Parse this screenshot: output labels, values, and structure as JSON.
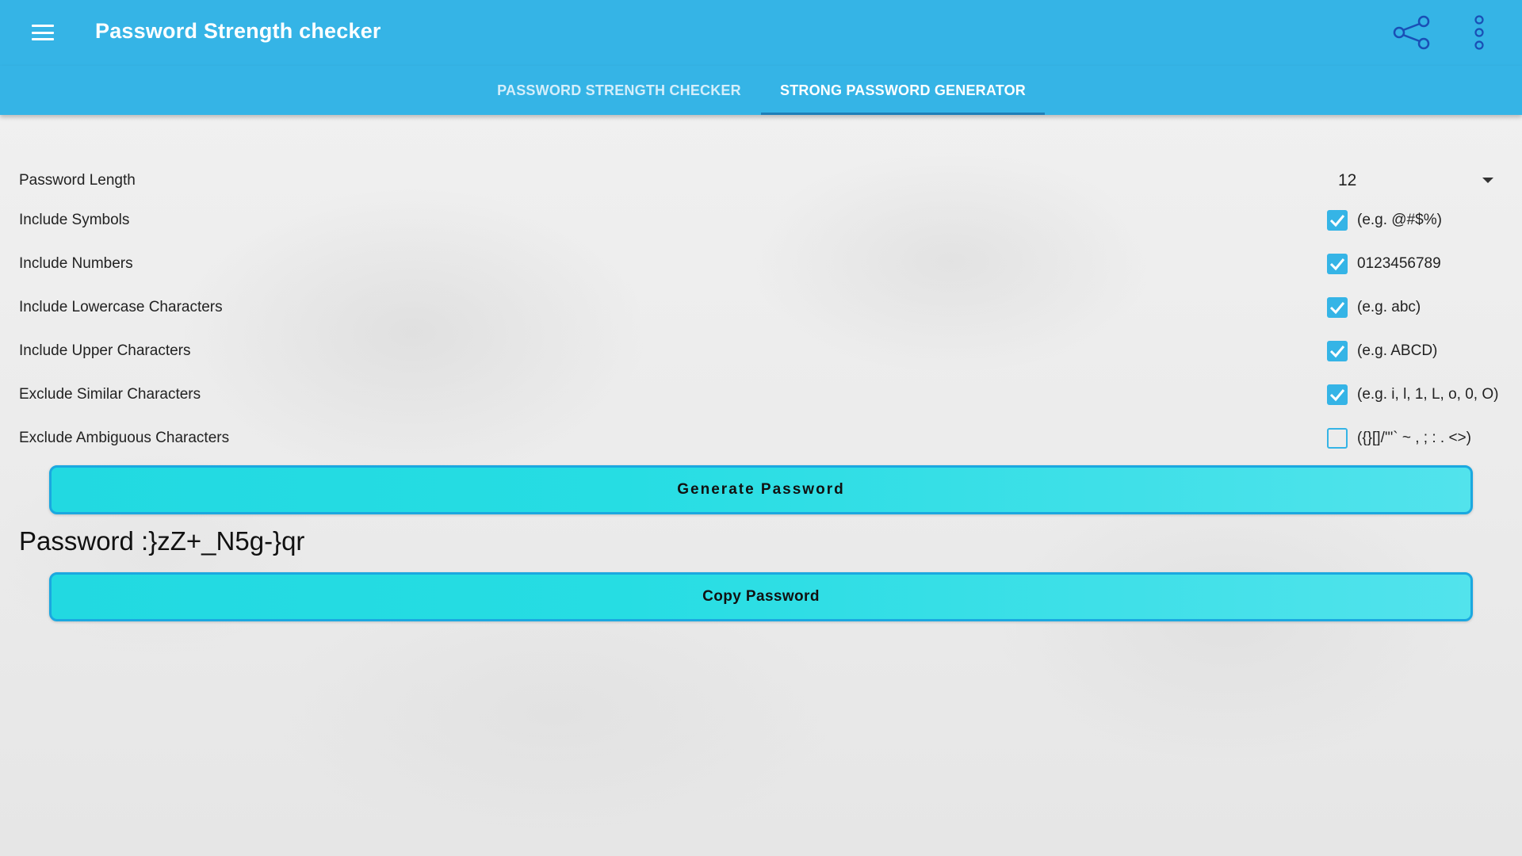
{
  "app": {
    "title": "Password Strength checker",
    "accent_color": "#35b4e6",
    "button_color": "#26dde3",
    "icons": {
      "menu": "hamburger-menu-icon",
      "share": "share-icon",
      "more": "more-vert-icon"
    }
  },
  "tabs": [
    {
      "label": "PASSWORD STRENGTH CHECKER",
      "active": false
    },
    {
      "label": "STRONG PASSWORD GENERATOR",
      "active": true
    }
  ],
  "settings": {
    "length": {
      "label": "Password Length",
      "value": "12"
    },
    "options": [
      {
        "label": "Include Symbols",
        "hint": "(e.g. @#$%)",
        "checked": true
      },
      {
        "label": "Include Numbers",
        "hint": "0123456789",
        "checked": true
      },
      {
        "label": "Include Lowercase Characters",
        "hint": "(e.g. abc)",
        "checked": true
      },
      {
        "label": "Include Upper Characters",
        "hint": "(e.g. ABCD)",
        "checked": true
      },
      {
        "label": "Exclude Similar Characters",
        "hint": "(e.g. i, l, 1, L, o, 0, O)",
        "checked": true
      },
      {
        "label": "Exclude Ambiguous Characters",
        "hint": "({}[]/'\"` ~ , ; : . <>)",
        "checked": false
      }
    ]
  },
  "actions": {
    "generate_label": "Generate Password",
    "copy_label": "Copy Password"
  },
  "result": {
    "password_text": "Password :}zZ+_N5g-}qr"
  }
}
